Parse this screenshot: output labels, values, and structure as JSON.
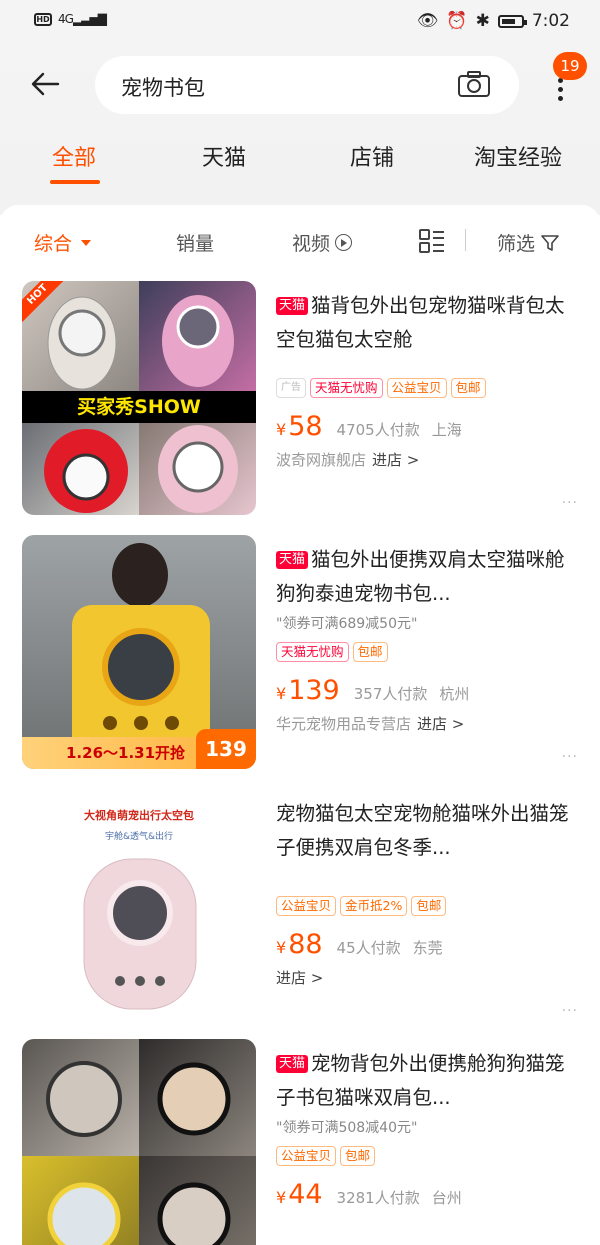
{
  "status_bar": {
    "left_indicator": "HD",
    "signal": "4G",
    "time": "7:02"
  },
  "search": {
    "query": "宠物书包",
    "message_count": "19"
  },
  "tabs": [
    {
      "label": "全部",
      "active": true
    },
    {
      "label": "天猫",
      "active": false
    },
    {
      "label": "店铺",
      "active": false
    },
    {
      "label": "淘宝经验",
      "active": false
    }
  ],
  "sort_bar": {
    "comprehensive": "综合",
    "sales": "销量",
    "video": "视频",
    "filter": "筛选"
  },
  "colors": {
    "accent": "#ff5000",
    "tmall_red": "#ff0036"
  },
  "products": [
    {
      "tmall": true,
      "badge": "天猫",
      "title": "猫背包外出包宠物猫咪背包太空包猫包太空舱",
      "coupon": "",
      "tags": [
        {
          "text": "广告",
          "style": "ad"
        },
        {
          "text": "天猫无忧购",
          "style": "red"
        },
        {
          "text": "公益宝贝",
          "style": "orange"
        },
        {
          "text": "包邮",
          "style": "orange"
        }
      ],
      "currency": "¥",
      "price": "58",
      "sales": "4705人付款",
      "location": "上海",
      "shop": "波奇网旗舰店",
      "enter_shop": "进店 >",
      "more": "···",
      "image": {
        "hot": "HOT",
        "banner": "买家秀SHOW"
      }
    },
    {
      "tmall": true,
      "badge": "天猫",
      "title": "猫包外出便携双肩太空猫咪舱狗狗泰迪宠物书包...",
      "coupon": "\"领券可满689减50元\"",
      "tags": [
        {
          "text": "天猫无忧购",
          "style": "red"
        },
        {
          "text": "包邮",
          "style": "orange"
        }
      ],
      "currency": "¥",
      "price": "139",
      "sales": "357人付款",
      "location": "杭州",
      "shop": "华元宠物用品专营店",
      "enter_shop": "进店 >",
      "more": "···",
      "image": {
        "promo_date": "1.26～1.31开抢",
        "promo_price": "139"
      }
    },
    {
      "tmall": false,
      "badge": "",
      "title": "宠物猫包太空宠物舱猫咪外出猫笼子便携双肩包冬季...",
      "coupon": "",
      "tags": [
        {
          "text": "公益宝贝",
          "style": "orange"
        },
        {
          "text": "金币抵2%",
          "style": "orange"
        },
        {
          "text": "包邮",
          "style": "orange"
        }
      ],
      "currency": "¥",
      "price": "88",
      "sales": "45人付款",
      "location": "东莞",
      "shop": "",
      "enter_shop": "进店 >",
      "more": "···",
      "image": {
        "caption": "大视角萌宠出行太空包",
        "subcaption": "宇舱&透气&出行"
      }
    },
    {
      "tmall": true,
      "badge": "天猫",
      "title": "宠物背包外出便携舱狗狗猫笼子书包猫咪双肩包...",
      "coupon": "\"领券可满508减40元\"",
      "tags": [
        {
          "text": "公益宝贝",
          "style": "orange"
        },
        {
          "text": "包邮",
          "style": "orange"
        }
      ],
      "currency": "¥",
      "price": "44",
      "sales": "3281人付款",
      "location": "台州",
      "shop": "",
      "enter_shop": "",
      "more": "",
      "image": {}
    }
  ]
}
